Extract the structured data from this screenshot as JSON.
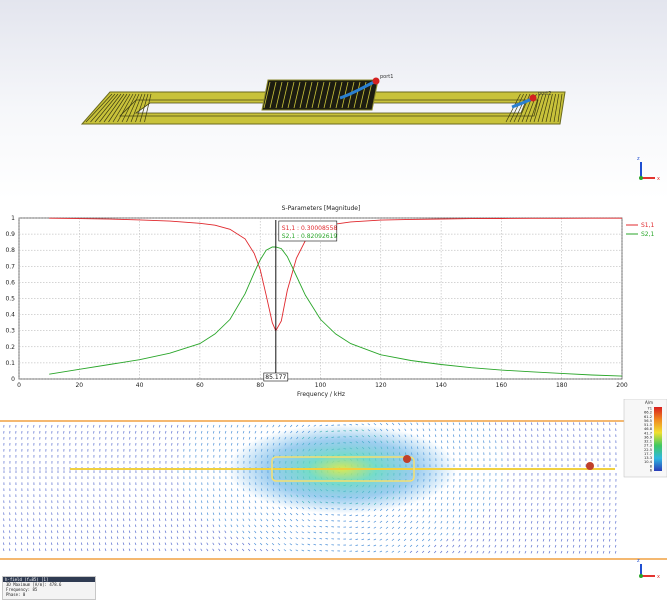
{
  "model_view": {
    "port1_label": "port1",
    "port2_label": "port2",
    "axes": {
      "x": "x",
      "z": "z"
    }
  },
  "colors": {
    "s11": "#e0282d",
    "s21": "#2aa62a",
    "coil": "#c8c23a",
    "port": "#d42020",
    "axis_z": "#1f4fd1",
    "axis_x": "#e3342f",
    "field_border": "#f0a040"
  },
  "chart_data": {
    "type": "line",
    "title": "S-Parameters [Magnitude]",
    "xlabel": "Frequency / kHz",
    "ylabel": "",
    "xlim": [
      0,
      200
    ],
    "ylim": [
      0,
      1
    ],
    "x_ticks": [
      "0",
      "20",
      "40",
      "60",
      "80",
      "100",
      "120",
      "140",
      "160",
      "180",
      "200"
    ],
    "y_ticks": [
      "0",
      "0.1",
      "0.2",
      "0.3",
      "0.4",
      "0.5",
      "0.6",
      "0.7",
      "0.8",
      "0.9",
      "1"
    ],
    "grid": true,
    "legend_position": "right",
    "marker": {
      "x": 85.177,
      "x_label": "85.177"
    },
    "annotation": {
      "s11": "S1,1 : 0.30008558",
      "s21": "S2,1 : 0.82092619"
    },
    "series": [
      {
        "name": "S1,1",
        "x": [
          10,
          20,
          30,
          40,
          50,
          60,
          65,
          70,
          75,
          78,
          80,
          82,
          84,
          85.177,
          87,
          89,
          92,
          95,
          100,
          105,
          110,
          120,
          130,
          140,
          150,
          160,
          170,
          180,
          190,
          200
        ],
        "values": [
          0.999,
          0.996,
          0.993,
          0.988,
          0.981,
          0.967,
          0.955,
          0.93,
          0.87,
          0.78,
          0.68,
          0.52,
          0.35,
          0.3,
          0.36,
          0.55,
          0.75,
          0.86,
          0.935,
          0.962,
          0.976,
          0.987,
          0.991,
          0.994,
          0.996,
          0.997,
          0.998,
          0.998,
          0.999,
          0.999
        ]
      },
      {
        "name": "S2,1",
        "x": [
          10,
          20,
          30,
          40,
          50,
          60,
          65,
          70,
          75,
          78,
          80,
          82,
          84,
          85.177,
          87,
          89,
          92,
          95,
          100,
          105,
          110,
          120,
          130,
          140,
          150,
          160,
          170,
          180,
          190,
          200
        ],
        "values": [
          0.03,
          0.06,
          0.09,
          0.12,
          0.16,
          0.22,
          0.28,
          0.37,
          0.53,
          0.66,
          0.74,
          0.8,
          0.82,
          0.82,
          0.81,
          0.76,
          0.64,
          0.52,
          0.37,
          0.28,
          0.22,
          0.15,
          0.115,
          0.09,
          0.07,
          0.055,
          0.045,
          0.035,
          0.025,
          0.018
        ]
      }
    ]
  },
  "field_view": {
    "legend_unit": "A/m",
    "legend_ticks": [
      "71",
      "66.2",
      "61.2",
      "56.5",
      "51.5",
      "46.8",
      "41.7",
      "36.9",
      "32.1",
      "27.3",
      "22.5",
      "17.7",
      "13.3",
      "10.4",
      "8",
      "6"
    ],
    "info": {
      "title": "h-field (f=85) [1]",
      "rows": [
        {
          "label": "3D Maximum [A/m]:",
          "value": "478.6"
        },
        {
          "label": "Frequency:",
          "value": "85"
        },
        {
          "label": "Phase:",
          "value": "0"
        }
      ]
    }
  }
}
